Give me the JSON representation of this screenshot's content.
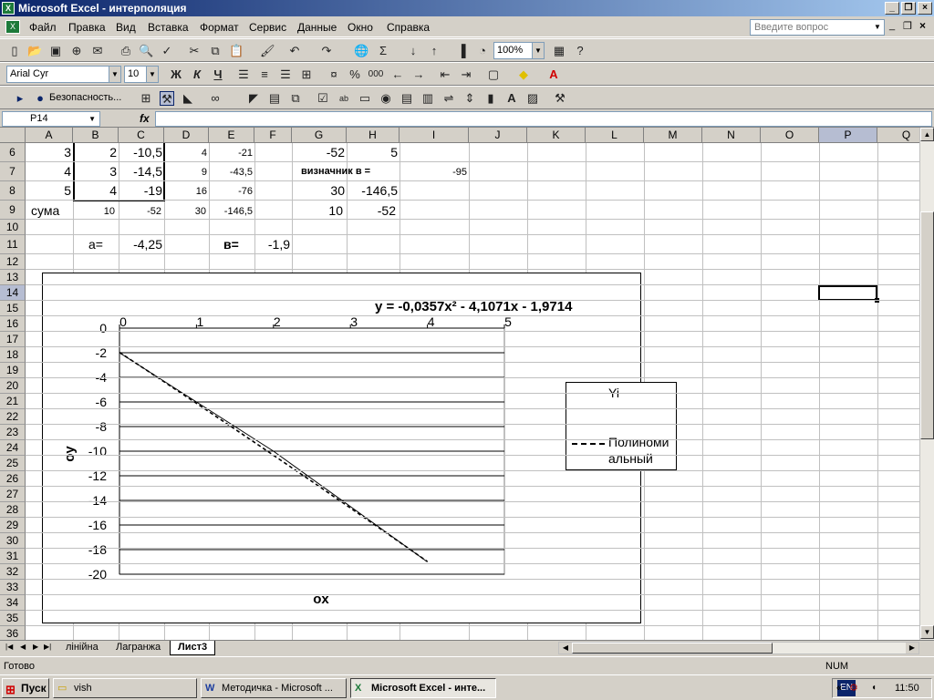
{
  "window": {
    "title": "Microsoft Excel - интерполяция",
    "app_icon": "excel-icon"
  },
  "menu": [
    "Файл",
    "Правка",
    "Вид",
    "Вставка",
    "Формат",
    "Сервис",
    "Данные",
    "Окно",
    "Справка"
  ],
  "help_box": {
    "placeholder": "Введите вопрос"
  },
  "standard_toolbar": {
    "zoom": "100%"
  },
  "format_toolbar": {
    "font": "Arial Cyr",
    "size": "10",
    "bold": "Ж",
    "italic": "К",
    "underline": "Ч",
    "percent": "%",
    "thousands": "000"
  },
  "security_toolbar": {
    "label": "Безопасность..."
  },
  "formula_bar": {
    "name_box": "P14",
    "fx": "fx",
    "content": ""
  },
  "columns": [
    "A",
    "B",
    "C",
    "D",
    "E",
    "F",
    "G",
    "H",
    "I",
    "J",
    "K",
    "L",
    "M",
    "N",
    "O",
    "P",
    "Q"
  ],
  "rows": [
    "6",
    "7",
    "8",
    "9",
    "10",
    "11",
    "12",
    "13",
    "14",
    "15",
    "16",
    "17",
    "18",
    "19",
    "20",
    "21",
    "22",
    "23",
    "24",
    "25",
    "26",
    "27",
    "28",
    "29",
    "30",
    "31",
    "32",
    "33",
    "34",
    "35",
    "36"
  ],
  "cells": {
    "A6": "3",
    "B6": "2",
    "C6": "-10,5",
    "D6": "4",
    "E6": "-21",
    "G6": "-52",
    "H6": "5",
    "A7": "4",
    "B7": "3",
    "C7": "-14,5",
    "D7": "9",
    "E7": "-43,5",
    "G7": "визначник в  =",
    "I7": "-95",
    "A8": "5",
    "B8": "4",
    "C8": "-19",
    "D8": "16",
    "E8": "-76",
    "G8": "30",
    "H8": "-146,5",
    "A9": "сума",
    "B9": "10",
    "C9": "-52",
    "D9": "30",
    "E9": "-146,5",
    "G9": "10",
    "H9": "-52",
    "B11": "a=",
    "C11": "-4,25",
    "E11": "в=",
    "F11": "-1,9"
  },
  "chart_data": {
    "type": "line",
    "trendline_label": "y = -0,0357x² - 4,1071x - 1,9714",
    "xlabel": "ox",
    "ylabel": "oy",
    "xlim": [
      0,
      5
    ],
    "ylim": [
      -20,
      0
    ],
    "x_ticks": [
      "0",
      "1",
      "2",
      "3",
      "4",
      "5"
    ],
    "y_ticks": [
      "0",
      "-2",
      "-4",
      "-6",
      "-8",
      "-10",
      "-12",
      "-14",
      "-16",
      "-18",
      "-20"
    ],
    "grid": "horizontal",
    "legend_position": "right",
    "series": [
      {
        "name": "Yi",
        "style": "solid",
        "x": [
          0,
          1,
          2,
          3,
          4
        ],
        "y": [
          -2,
          -6,
          -10,
          -14.5,
          -19
        ]
      },
      {
        "name": "Полиномиальный",
        "style": "dashed",
        "x": [
          0,
          0.5,
          1,
          1.5,
          2,
          2.5,
          3,
          3.5,
          4
        ],
        "y": [
          -1.97,
          -4.03,
          -6.11,
          -8.21,
          -10.33,
          -12.46,
          -14.62,
          -16.79,
          -18.97
        ]
      }
    ],
    "legend_entries": [
      "Yi",
      "Полиноми",
      "альный"
    ]
  },
  "sheet_tabs": [
    "лінійна",
    "Лагранжа",
    "Лист3"
  ],
  "active_tab": "Лист3",
  "status": {
    "left": "Готово",
    "num": "NUM"
  },
  "taskbar": {
    "start": "Пуск",
    "tasks": [
      "vish",
      "Методичка - Microsoft ...",
      "Microsoft Excel - инте..."
    ],
    "lang": "EN",
    "time": "11:50"
  }
}
